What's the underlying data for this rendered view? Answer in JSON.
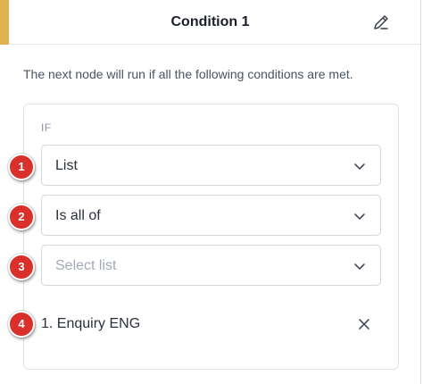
{
  "header": {
    "title": "Condition 1",
    "accent_color": "#e2b24f",
    "edit_icon": "pencil-icon"
  },
  "description": "The next node will run if all the following conditions are met.",
  "condition": {
    "if_label": "IF",
    "field_select": {
      "value": "List"
    },
    "operator_select": {
      "value": "Is all of"
    },
    "list_select": {
      "placeholder": "Select list"
    },
    "selected_item": {
      "label": "1. Enquiry ENG",
      "remove_icon": "close-icon"
    }
  },
  "badges": [
    "1",
    "2",
    "3",
    "4"
  ],
  "colors": {
    "badge": "#d9302b",
    "placeholder": "#a3aab5"
  }
}
